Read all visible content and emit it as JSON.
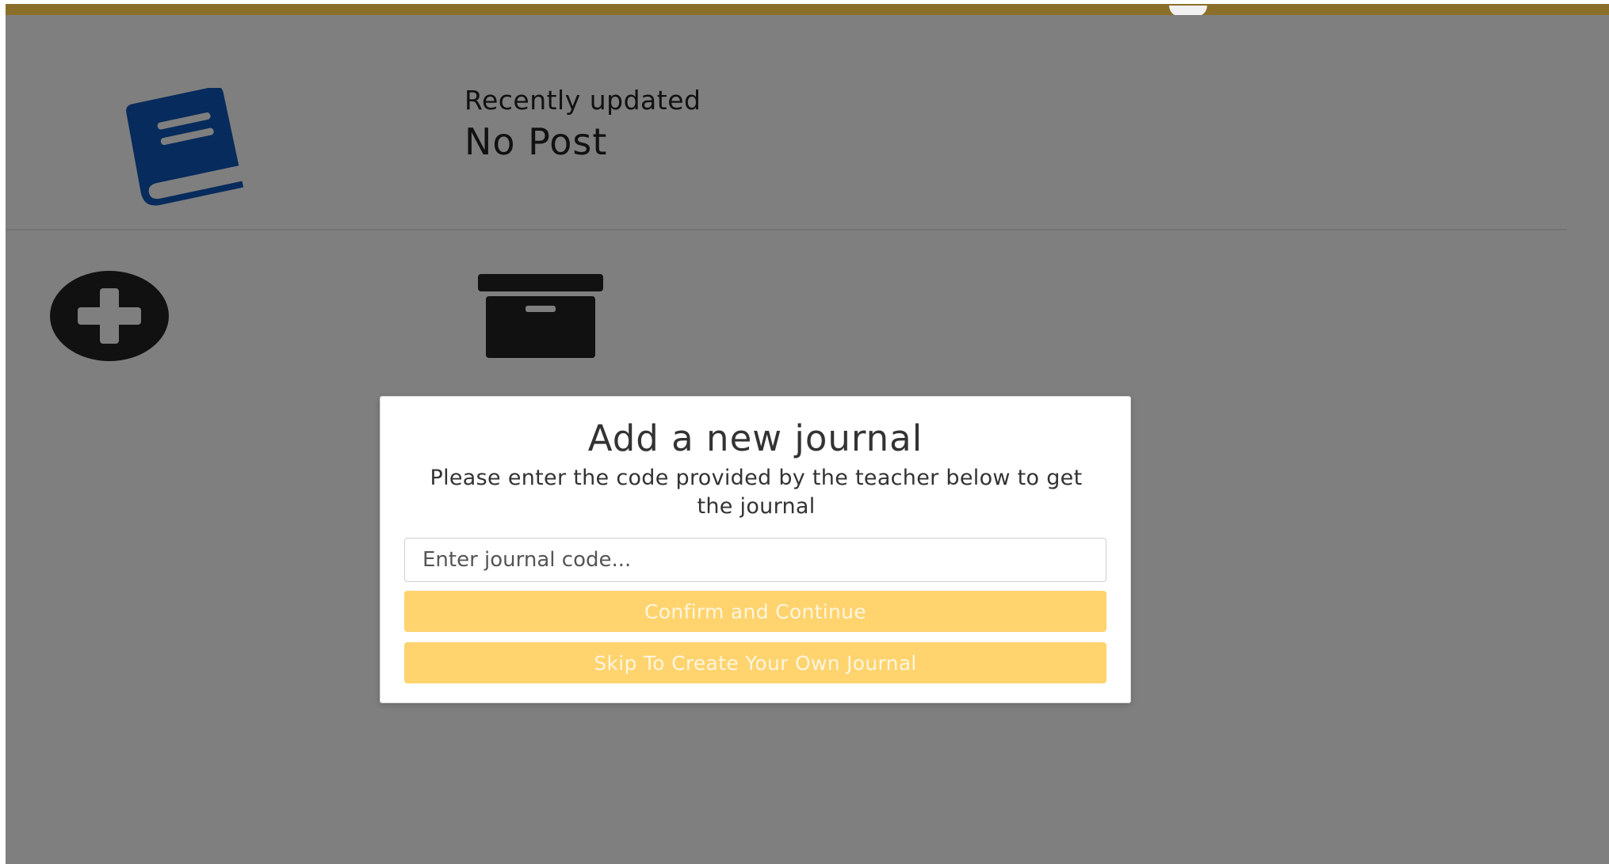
{
  "header": {
    "accent_color": "#8a6f2a"
  },
  "recent": {
    "label": "Recently updated",
    "value": "No Post",
    "icon": "book-icon",
    "icon_color": "#0c57b8"
  },
  "actions": {
    "add_icon": "plus-circle-icon",
    "archive_icon": "archive-box-icon"
  },
  "modal": {
    "title": "Add a new journal",
    "subtitle": "Please enter the code provided by the teacher below to get the journal",
    "input_placeholder": "Enter journal code...",
    "input_value": "",
    "confirm_label": "Confirm and Continue",
    "skip_label": "Skip To Create Your Own Journal",
    "button_color": "#ffd36e"
  }
}
